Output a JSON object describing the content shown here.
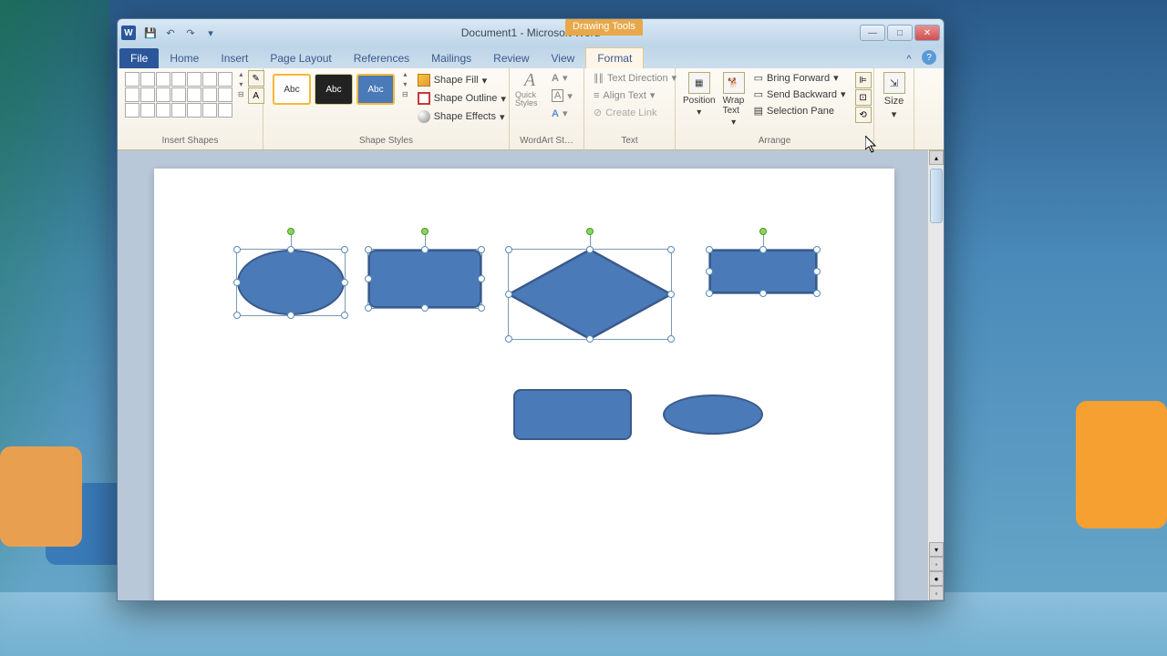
{
  "title": "Document1 - Microsoft Word",
  "contextual": "Drawing Tools",
  "word_letter": "W",
  "qat": {
    "save": "💾",
    "undo": "↶",
    "redo": "↷",
    "more": "▾"
  },
  "win": {
    "min": "—",
    "max": "□",
    "close": "✕"
  },
  "tabs": {
    "file": "File",
    "home": "Home",
    "insert": "Insert",
    "page_layout": "Page Layout",
    "references": "References",
    "mailings": "Mailings",
    "review": "Review",
    "view": "View",
    "format": "Format"
  },
  "help": {
    "collapse": "^",
    "q": "?"
  },
  "groups": {
    "insert_shapes": "Insert Shapes",
    "shape_styles": "Shape Styles",
    "wordart": "WordArt St…",
    "text": "Text",
    "arrange": "Arrange",
    "size": "Size"
  },
  "shape_styles": {
    "abc": "Abc",
    "fill": "Shape Fill",
    "outline": "Shape Outline",
    "effects": "Shape Effects"
  },
  "wordart": {
    "quick": "Quick Styles",
    "a_glyph": "A",
    "fill": "A",
    "outline": "A",
    "effects": "A"
  },
  "text": {
    "direction": "Text Direction",
    "align": "Align Text",
    "link": "Create Link"
  },
  "arrange": {
    "position": "Position",
    "wrap": "Wrap Text",
    "forward": "Bring Forward",
    "backward": "Send Backward",
    "pane": "Selection Pane",
    "align": "⊫",
    "group": "⊡",
    "rotate": "⟲"
  },
  "size": {
    "label": "Size"
  },
  "dropdown_caret": "▾"
}
